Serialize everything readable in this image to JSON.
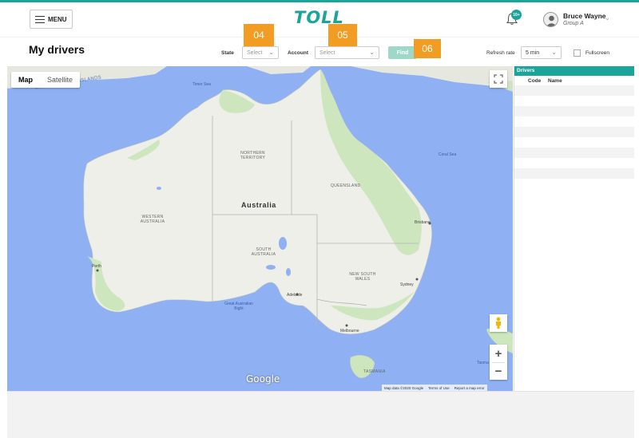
{
  "header": {
    "menu_label": "MENU",
    "logo_text": "TOLL",
    "notification_count": "10+",
    "user_name": "Bruce Wayne",
    "user_group": "Group A"
  },
  "toolbar": {
    "page_title": "My drivers",
    "state_label": "State",
    "state_placeholder": "Select",
    "account_label": "Account",
    "account_placeholder": "Select",
    "find_label": "Find",
    "refresh_label": "Refresh rate",
    "refresh_value": "5 min",
    "fullscreen_label": "Fullscreen",
    "callouts": [
      "04",
      "05",
      "06"
    ]
  },
  "map": {
    "type_map": "Map",
    "type_satellite": "Satellite",
    "zoom_in": "+",
    "zoom_out": "−",
    "country": "Australia",
    "labels": {
      "timor_sea": "Timor Sea",
      "coral_sea": "Coral Sea",
      "bight": "Great Australian Bight",
      "tasman": "Tasma",
      "nt": "NORTHERN TERRITORY",
      "qld": "QUEENSLAND",
      "wa": "WESTERN AUSTRALIA",
      "sa": "SOUTH AUSTRALIA",
      "nsw": "NEW SOUTH WALES",
      "tas": "TASMANIA",
      "brisbane": "Brisbane",
      "sydney": "Sydney",
      "perth": "Perth",
      "adelaide": "Adelaide",
      "melbourne": "Melbourne",
      "sunda": "GREATER SUNDA ISLANDS"
    },
    "google": "Google",
    "attribution": [
      "Map data ©2020 Google",
      "Terms of Use",
      "Report a map error"
    ]
  },
  "drivers": {
    "title": "Drivers",
    "columns": [
      "Code",
      "Name"
    ]
  },
  "colors": {
    "accent": "#1aa59a",
    "callout": "#f39c23",
    "find_button": "#9fd8c9"
  }
}
